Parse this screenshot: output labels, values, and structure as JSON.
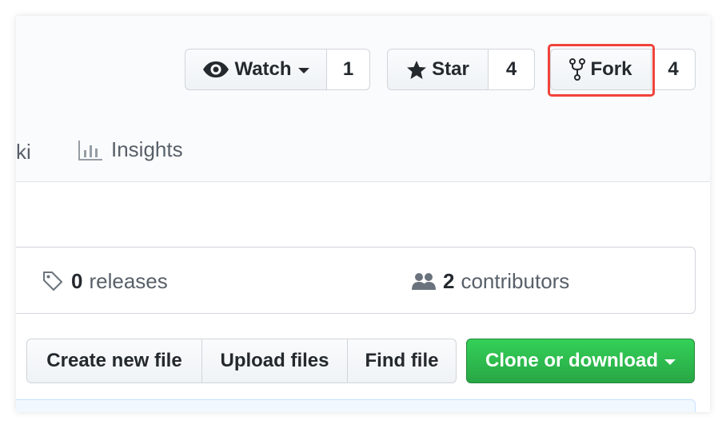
{
  "actions": {
    "watch": {
      "label": "Watch",
      "count": "1",
      "icon": "eye-icon"
    },
    "star": {
      "label": "Star",
      "count": "4",
      "icon": "star-icon"
    },
    "fork": {
      "label": "Fork",
      "count": "4",
      "icon": "repo-forked-icon",
      "highlight_color": "#f0433b"
    }
  },
  "tabs": [
    {
      "label": "ki"
    },
    {
      "label": "Insights",
      "icon": "graph-icon"
    }
  ],
  "summary": {
    "releases": {
      "count": "0",
      "label": "releases",
      "icon": "tag-icon"
    },
    "contributors": {
      "count": "2",
      "label": "contributors",
      "icon": "people-icon"
    }
  },
  "file_actions": {
    "create": "Create new file",
    "upload": "Upload files",
    "find": "Find file",
    "clone": "Clone or download"
  },
  "colors": {
    "clone_green": "#2ea44f",
    "highlight_red": "#f0433b",
    "header_bg": "#fafbfc"
  }
}
